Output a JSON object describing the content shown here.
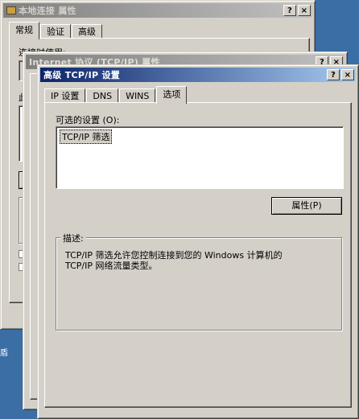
{
  "window1": {
    "title": "本地连接 属性",
    "tabs": [
      "常规",
      "验证",
      "高级"
    ],
    "connect_label": "连接时使用:",
    "partial_label": "此"
  },
  "window2": {
    "title": "Internet 协议 (TCP/IP) 属性"
  },
  "window3": {
    "title": "高级 TCP/IP 设置",
    "tabs": [
      "IP 设置",
      "DNS",
      "WINS",
      "选项"
    ],
    "optional_label": "可选的设置 (O):",
    "optional_items": [
      "TCP/IP 筛选"
    ],
    "properties_button": "属性(P)",
    "desc_label": "描述:",
    "desc_line1": "TCP/IP 筛选允许您控制连接到您的 Windows 计算机的",
    "desc_line2": "TCP/IP 网络流量类型。"
  },
  "title_buttons": {
    "help": "?",
    "close": "×"
  },
  "desktop_text": "盾"
}
